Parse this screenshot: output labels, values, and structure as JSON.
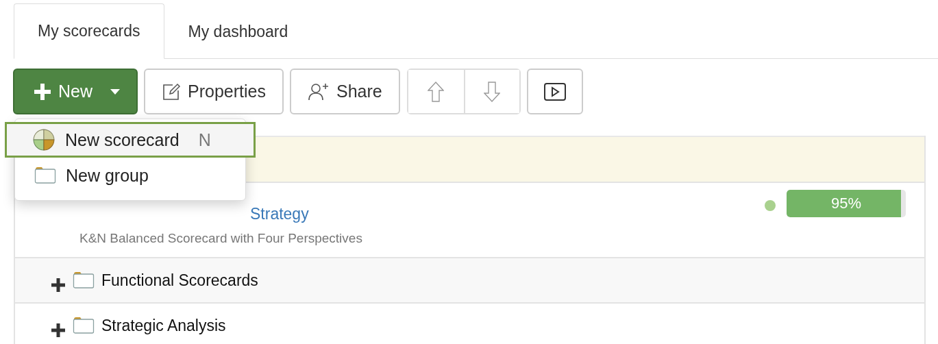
{
  "tabs": [
    {
      "label": "My scorecards",
      "selected": true
    },
    {
      "label": "My dashboard",
      "selected": false
    }
  ],
  "toolbar": {
    "new_button": "New",
    "properties_button": "Properties",
    "share_button": "Share"
  },
  "new_menu": {
    "items": [
      {
        "label": "New scorecard",
        "shortcut": "N",
        "kind": "scorecard",
        "selected": true
      },
      {
        "label": "New group",
        "kind": "group",
        "selected": false
      }
    ]
  },
  "rows": [
    {
      "kind": "scorecard",
      "title": "Strategy",
      "description": "K&N Balanced Scorecard with Four Perspectives",
      "color": "#a9d18e",
      "level": 0.96,
      "reading": "95%"
    },
    {
      "kind": "group",
      "title": "Functional Scorecards",
      "expanded": false
    },
    {
      "kind": "group",
      "title": "Strategic Analysis",
      "expanded": false
    }
  ]
}
